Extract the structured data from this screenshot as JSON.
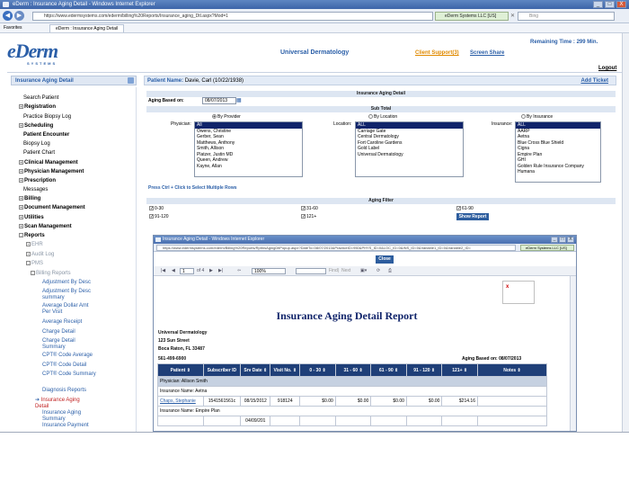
{
  "browser": {
    "title": "eDerm : Insurance Aging Detail - Windows Internet Explorer",
    "url": "https://www.edermsystems.com/ederm/billing%20Reports/Insurance_aging_Dtl.aspx?Mod=1",
    "cert": "eDerm Systems LLC [US]",
    "search_placeholder": "Bing",
    "favorites_label": "Favorites",
    "tab_label": "eDerm : Insurance Aging Detail",
    "window_buttons": [
      "_",
      "□",
      "X"
    ]
  },
  "header": {
    "logo_text": "eDerm",
    "logo_sub": "SYSTEMS",
    "practice": "Universal Dermatology",
    "remaining_time": "Remaining Time : 299 Min.",
    "client_support": "Client Support(3)",
    "screen_share": "Screen Share",
    "logout": "Logout"
  },
  "sidebar": {
    "title": "Insurance Aging Detail",
    "items": [
      {
        "label": "Search Patient",
        "style": "plain",
        "pm": ""
      },
      {
        "label": "Registration",
        "style": "b",
        "pm": "+"
      },
      {
        "label": "Practice Biopsy Log",
        "style": "plain",
        "pm": ""
      },
      {
        "label": "Scheduling",
        "style": "b",
        "pm": "+"
      },
      {
        "label": "Patient Encounter",
        "style": "b",
        "pm": ""
      },
      {
        "label": "Biopsy Log",
        "style": "plain",
        "pm": ""
      },
      {
        "label": "Patient Chart",
        "style": "plain",
        "pm": ""
      },
      {
        "label": "Clinical Management",
        "style": "b",
        "pm": "+"
      },
      {
        "label": "Physician Management",
        "style": "b",
        "pm": "+"
      },
      {
        "label": "Prescription",
        "style": "b",
        "pm": "+"
      },
      {
        "label": "Messages",
        "style": "plain",
        "pm": ""
      },
      {
        "label": "Billing",
        "style": "b",
        "pm": "+"
      },
      {
        "label": "Document Management",
        "style": "b",
        "pm": "+"
      },
      {
        "label": "Utilities",
        "style": "b",
        "pm": "+"
      },
      {
        "label": "Scan Management",
        "style": "b",
        "pm": "+"
      },
      {
        "label": "Reports",
        "style": "b",
        "pm": "-"
      },
      {
        "label": "EHR",
        "style": "gray",
        "pm": "+"
      },
      {
        "label": "Audit Log",
        "style": "gray",
        "pm": "+"
      },
      {
        "label": "PMS",
        "style": "gray",
        "pm": "-"
      },
      {
        "label": "Billing Reports",
        "style": "gray",
        "pm": "-"
      }
    ],
    "reports": [
      "Adjustment By Desc",
      "Adjustment By Desc summary",
      "Average Dollar Amt Per Visit",
      "Average Receipt",
      "Charge Detail",
      "Charge Detail Summary",
      "CPT® Code Average",
      "CPT® Code Detail",
      "CPT® Code Summary",
      "Diagnosis Reports",
      "Insurance Aging Detail",
      "Insurance Aging Summary",
      "Insurance Payment"
    ]
  },
  "main": {
    "patient_label": "Patient Name:",
    "patient_name": "Davie, Carl (10/22/1938)",
    "add_ticket": "Add Ticket",
    "section_title": "Insurance Aging Detail",
    "aging_based_label": "Aging Based on:",
    "aging_date": "08/07/2013",
    "subtotal_title": "Sub Total",
    "radio_provider": "By Provider",
    "radio_location": "By Location",
    "radio_insurance": "By Insurance",
    "physician_label": "Physician:",
    "location_label": "Location:",
    "insurance_label": "Insurance:",
    "physicians": [
      "All",
      "Owens, Christine",
      "Gerber, Sean",
      "Matthews, Anthony",
      "Smith, Allison",
      "Platzer, Justin MD",
      "Queen, Andrew",
      "Kayne, Allan"
    ],
    "locations": [
      "ALL",
      "Carriage Gate",
      "Central Dermatology",
      "Fort Caroline Gardens",
      "Gold Label",
      "Universal Dermatology"
    ],
    "insurances": [
      "ALL",
      "AARP",
      "Aetna",
      "Blue Cross Blue Shield",
      "Cigna",
      "Empire Plan",
      "GHI",
      "Golden Rule Insurance Company",
      "Humana"
    ],
    "hint": "Press Ctrl + Click to Select Multiple Rows",
    "aging_filter_title": "Aging Filter",
    "filters": [
      "0-30",
      "31-60",
      "61-90",
      "91-120",
      "121+"
    ],
    "show_report": "Show Report"
  },
  "popup": {
    "title": "Insurance Aging Detail - Windows Internet Explorer",
    "url": "https://www.edermsystems.com/ederm/Billing%20Reports/RptInsAgingDtlPopup.aspx?DateTo=08/07/2013&PracticeID=950&PHYS_ID=0&LOC_ID=0&INS_ID=0&Variable1_ID=0&Variable2_ID=",
    "cert": "eDerm Systems LLC [US]",
    "close": "Close",
    "page": "1",
    "page_of": "of 4",
    "zoom": "100%",
    "find": "Find",
    "next": "Next",
    "broken_img": "x",
    "report_title": "Insurance Aging Detail Report",
    "addr1": "Universal Dermatology",
    "addr2": "123 Sun Street",
    "addr3": "Boca Raton, FL 33487",
    "phone": "561-499-6900",
    "aging_as_of": "Aging Based on: 08/07/2013",
    "columns": [
      "Patient",
      "Subscriber ID",
      "Srv Date",
      "Visit No.",
      "0 - 30",
      "31 - 60",
      "61 - 90",
      "91 - 120",
      "121+",
      "Notes"
    ],
    "physician_row": "Physician: Allison Smith",
    "ins_row1": "Insurance Name: Aetna",
    "row1": [
      "Chaps, Stephanie",
      "1541561561c",
      "08/15/2012",
      "918124",
      "$0.00",
      "$0.00",
      "$0.00",
      "$0.00",
      "$214.16",
      ""
    ],
    "ins_row2": "Insurance Name: Empire Plan",
    "row2_date": "04/09/201"
  }
}
